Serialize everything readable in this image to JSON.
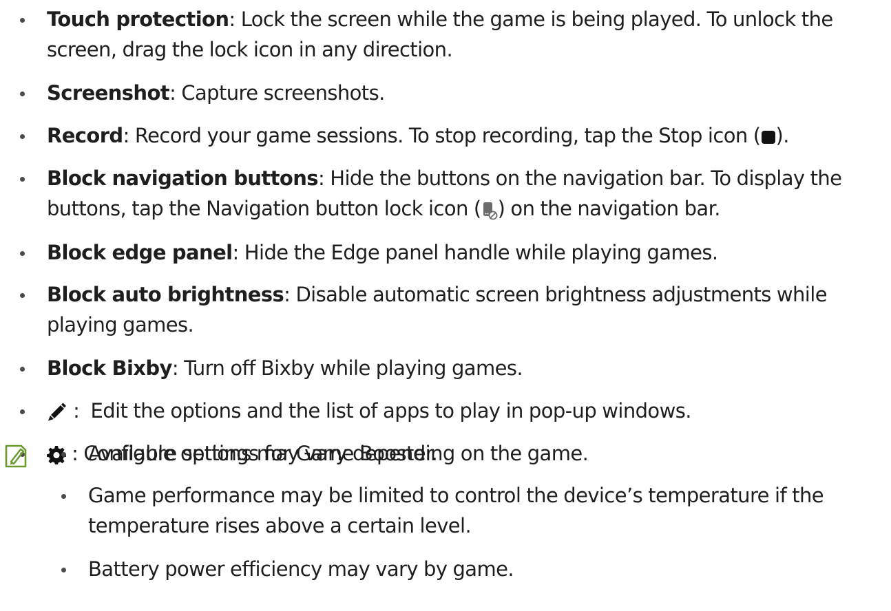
{
  "items": [
    {
      "term": "Touch protection",
      "separator": ":",
      "desc_line1": " Lock the screen while the game is being played. To unlock the",
      "desc_line2": "screen, drag the lock icon in any direction."
    },
    {
      "term": "Screenshot",
      "separator": ":",
      "desc": " Capture screenshots."
    },
    {
      "term": "Record",
      "separator": ":",
      "desc_before_icon": " Record your game sessions. To stop recording, tap the Stop icon (",
      "icon": "stop-icon",
      "desc_after_icon": ")."
    },
    {
      "term": "Block navigation buttons",
      "separator": ":",
      "desc_line1": " Hide the buttons on the navigation bar. To display the",
      "desc_line2_before_icon": "buttons, tap the Navigation button lock icon (",
      "icon": "navigation-button-lock-icon",
      "desc_line2_after_icon": ") on the navigation bar."
    },
    {
      "term": "Block edge panel",
      "separator": ":",
      "desc": " Hide the Edge panel handle while playing games."
    },
    {
      "term": "Block auto brightness",
      "separator": ":",
      "desc_line1": " Disable automatic screen brightness adjustments while",
      "desc_line2": "playing games."
    },
    {
      "term": "Block Bixby",
      "separator": ":",
      "desc": " Turn off Bixby while playing games."
    },
    {
      "icon": "pencil-icon",
      "separator": " :  ",
      "desc": "Edit the options and the list of apps to play in pop-up windows."
    },
    {
      "icon": "gear-icon",
      "separator": " : ",
      "desc": "Configure settings for Game Booster."
    }
  ],
  "note": {
    "icon": "note-icon",
    "icon_color": "#6a9a2e",
    "items": [
      {
        "text": "Available options may vary depending on the game."
      },
      {
        "line1": "Game performance may be limited to control the device’s temperature if the",
        "line2": "temperature rises above a certain level."
      },
      {
        "text": "Battery power efficiency may vary by game."
      }
    ]
  }
}
